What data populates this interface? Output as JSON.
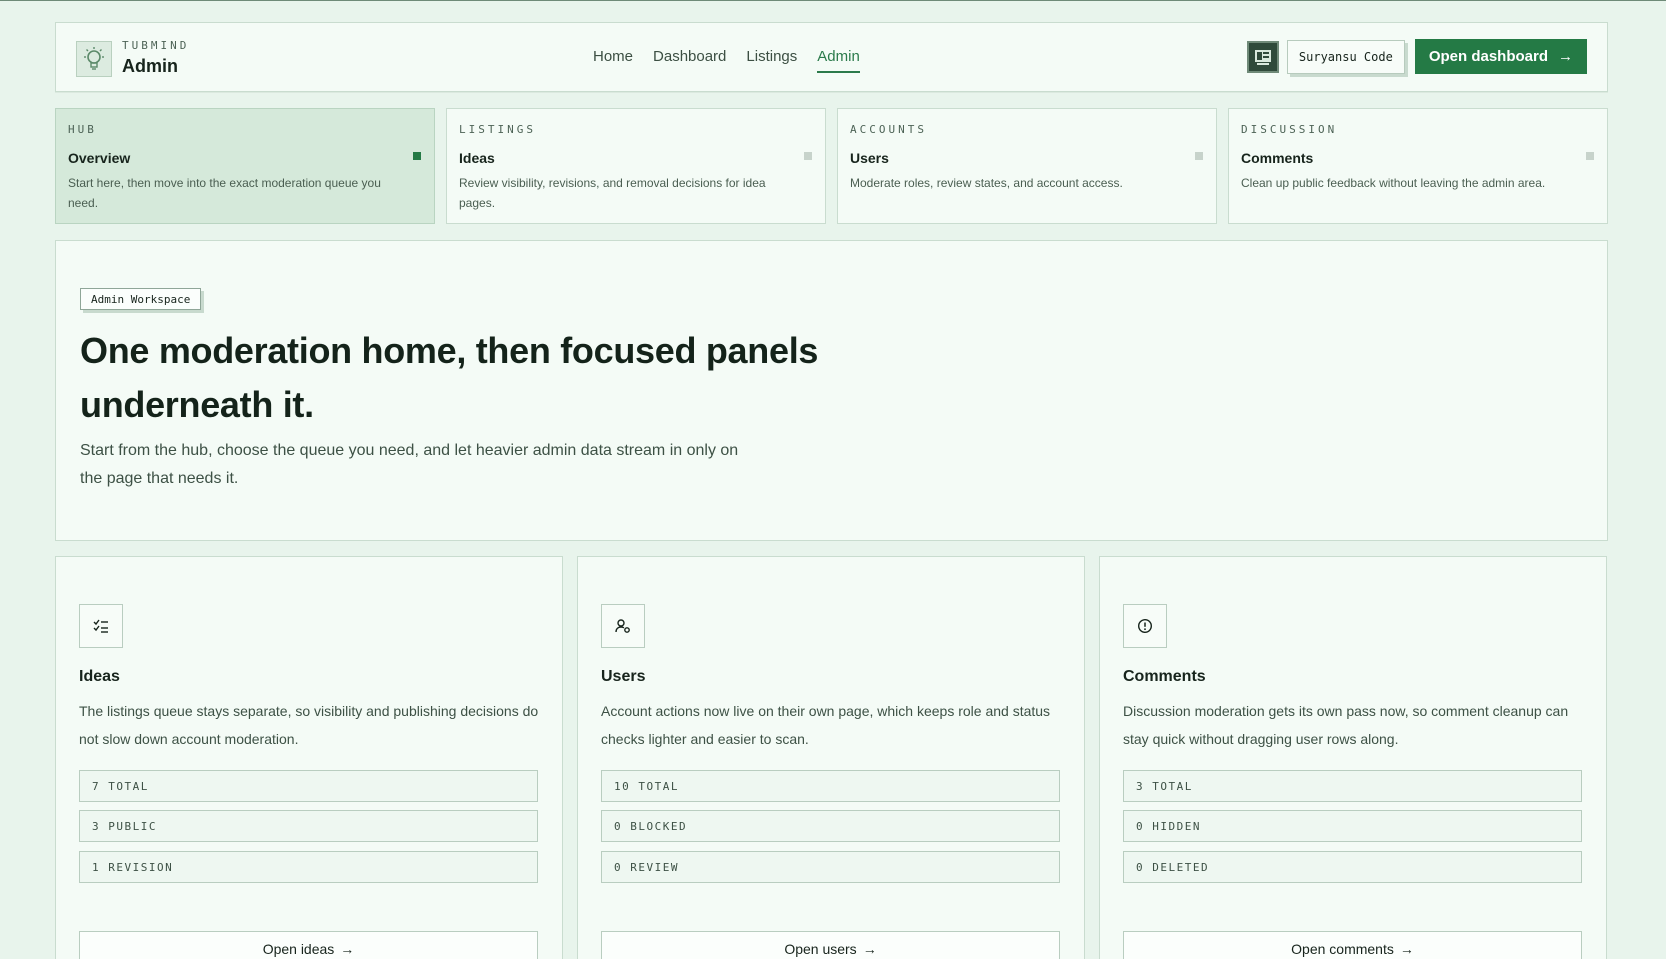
{
  "header": {
    "brand_eyebrow": "TUBMIND",
    "brand_title": "Admin",
    "nav": [
      {
        "label": "Home",
        "active": false
      },
      {
        "label": "Dashboard",
        "active": false
      },
      {
        "label": "Listings",
        "active": false
      },
      {
        "label": "Admin",
        "active": true
      }
    ],
    "user_name": "Suryansu Code",
    "open_dashboard_label": "Open dashboard",
    "arrow_icon": "arrow-right-icon"
  },
  "tabs": [
    {
      "eyebrow": "HUB",
      "title": "Overview",
      "desc": "Start here, then move into the exact moderation queue you need.",
      "active": true
    },
    {
      "eyebrow": "LISTINGS",
      "title": "Ideas",
      "desc": "Review visibility, revisions, and removal decisions for idea pages.",
      "active": false
    },
    {
      "eyebrow": "ACCOUNTS",
      "title": "Users",
      "desc": "Moderate roles, review states, and account access.",
      "active": false
    },
    {
      "eyebrow": "DISCUSSION",
      "title": "Comments",
      "desc": "Clean up public feedback without leaving the admin area.",
      "active": false
    }
  ],
  "hero": {
    "badge": "Admin Workspace",
    "title": "One moderation home, then focused panels underneath it.",
    "subtitle": "Start from the hub, choose the queue you need, and let heavier admin data stream in only on the page that needs it."
  },
  "cards": [
    {
      "icon": "checklist-icon",
      "title": "Ideas",
      "desc": "The listings queue stays separate, so visibility and publishing decisions do not slow down account moderation.",
      "stats": [
        "7 TOTAL",
        "3 PUBLIC",
        "1 REVISION"
      ],
      "button": "Open ideas"
    },
    {
      "icon": "user-gear-icon",
      "title": "Users",
      "desc": "Account actions now live on their own page, which keeps role and status checks lighter and easier to scan.",
      "stats": [
        "10 TOTAL",
        "0 BLOCKED",
        "0 REVIEW"
      ],
      "button": "Open users"
    },
    {
      "icon": "alert-circle-icon",
      "title": "Comments",
      "desc": "Discussion moderation gets its own pass now, so comment cleanup can stay quick without dragging user rows along.",
      "stats": [
        "3 TOTAL",
        "0 HIDDEN",
        "0 DELETED"
      ],
      "button": "Open comments"
    }
  ],
  "colors": {
    "accent": "#247a45",
    "background": "#e8f4ec",
    "panel": "#f4fbf6",
    "active_tab": "#d5e9da"
  }
}
